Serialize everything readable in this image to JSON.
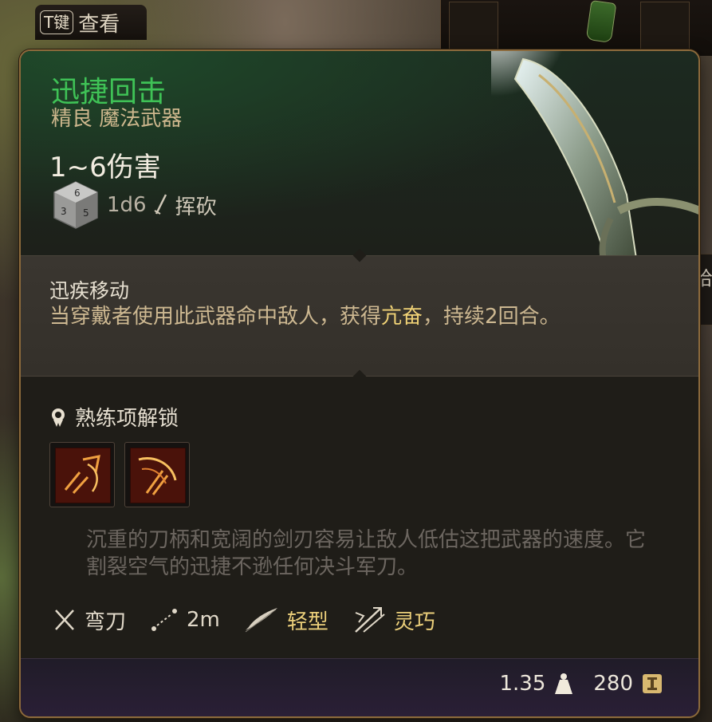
{
  "hint": {
    "key": "T键",
    "label": "查看"
  },
  "side_tab": "拾",
  "item": {
    "name": "迅捷回击",
    "subtitle": "精良 魔法武器",
    "damage": "1~6伤害",
    "dice": "1d6",
    "damage_type": "挥砍",
    "name_color": "#3fc256"
  },
  "ability": {
    "title": "迅疾移动",
    "desc_before": "当穿戴者使用此武器命中敌人，获得",
    "desc_highlight": "亢奋",
    "desc_after": "，持续2回合。"
  },
  "proficiency": {
    "title": "熟练项解锁",
    "actions": [
      "slash-attack-icon",
      "flourish-attack-icon"
    ]
  },
  "flavor": "沉重的刀柄和宽阔的剑刃容易让敌人低估这把武器的速度。它割裂空气的迅捷不逊任何决斗军刀。",
  "properties": [
    {
      "icon": "crossed-swords-icon",
      "label": "弯刀",
      "highlight": false
    },
    {
      "icon": "range-icon",
      "label": "2m",
      "highlight": false
    },
    {
      "icon": "feather-icon",
      "label": "轻型",
      "highlight": true
    },
    {
      "icon": "finesse-icon",
      "label": "灵巧",
      "highlight": true
    }
  ],
  "footer": {
    "weight": "1.35",
    "value": "280"
  }
}
